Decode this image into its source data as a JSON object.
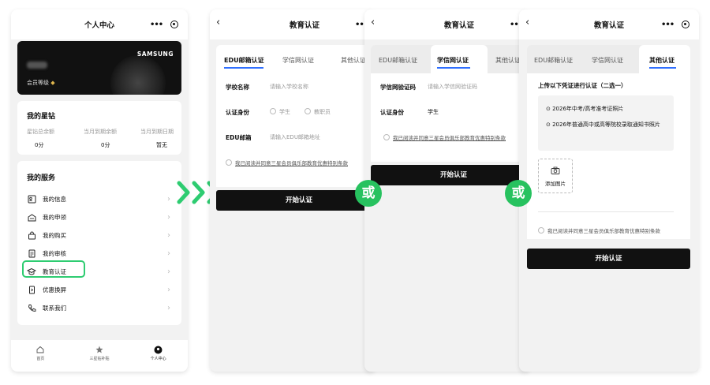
{
  "colors": {
    "accent_green": "#27c25f",
    "tab_underline": "#2f6fff",
    "button_black": "#111111"
  },
  "personal_center": {
    "title": "个人中心",
    "member_card": {
      "brand": "SAMSUNG",
      "level": "会员等级"
    },
    "star_diamond": {
      "title": "我的星钻",
      "columns": [
        {
          "label": "星钻总余额",
          "value": "0分"
        },
        {
          "label": "当月到期余额",
          "value": "0分"
        },
        {
          "label": "当月到期日期",
          "value": "暂无"
        }
      ]
    },
    "services": {
      "title": "我的服务",
      "items": [
        {
          "label": "我的信息",
          "icon": "id-card-icon"
        },
        {
          "label": "我的申领",
          "icon": "gift-icon"
        },
        {
          "label": "我的购买",
          "icon": "bag-icon"
        },
        {
          "label": "我的审核",
          "icon": "document-icon"
        },
        {
          "label": "教育认证",
          "icon": "graduation-cap-icon"
        },
        {
          "label": "优惠换屏",
          "icon": "phone-screen-icon"
        },
        {
          "label": "联系我们",
          "icon": "telephone-icon"
        }
      ]
    },
    "tabbar": [
      {
        "label": "首页",
        "icon": "home-icon"
      },
      {
        "label": "三星钻补贴",
        "icon": "star-icon"
      },
      {
        "label": "个人中心",
        "icon": "user-icon"
      }
    ]
  },
  "edu_verify": {
    "title": "教育认证",
    "tabs": [
      "EDU邮箱认证",
      "学信网认证",
      "其他认证"
    ],
    "edu_form": {
      "school_label": "学校名称",
      "school_placeholder": "请输入学校名称",
      "identity_label": "认证身份",
      "identity_options": [
        "学生",
        "教职员"
      ],
      "email_label": "EDU邮箱",
      "email_placeholder": "请输入EDU邮箱地址"
    },
    "chsi_form": {
      "code_label": "学信网验证码",
      "code_placeholder": "请输入学信网验证码",
      "identity_label": "认证身份",
      "identity_value": "学生"
    },
    "other_form": {
      "heading": "上传以下凭证进行认证（二选一）",
      "options": [
        "2026年中考/高考准考证照片",
        "2026年普通高中或高等院校录取通知书照片"
      ],
      "add_photo": "添加图片"
    },
    "agreement": "我已阅读并同意三星会员俱乐部教育优惠特别条款",
    "start_button": "开始认证"
  },
  "or_label": "或"
}
